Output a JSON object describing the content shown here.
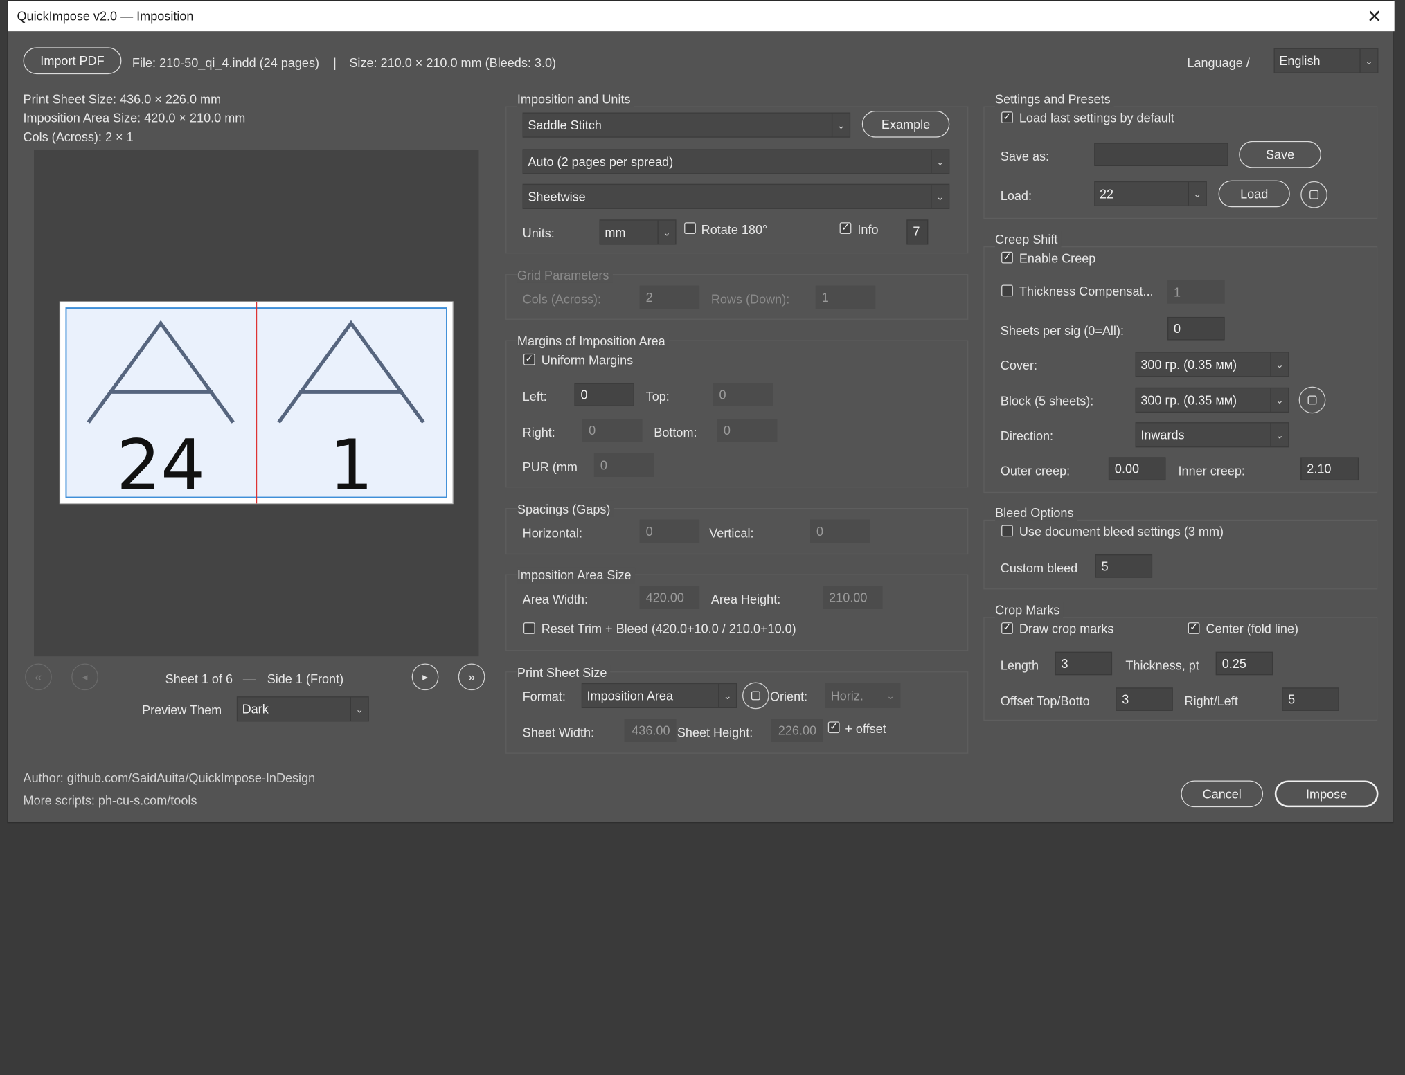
{
  "window": {
    "title": "QuickImpose v2.0 — Imposition"
  },
  "top": {
    "import_label": "Import PDF",
    "file_info": "File: 210-50_qi_4.indd (24 pages)",
    "separator": "|",
    "size_info": "Size: 210.0 × 210.0 mm (Bleeds: 3.0)",
    "language_label": "Language /",
    "language_value": "English"
  },
  "info": {
    "print_sheet": "Print Sheet Size: 436.0 × 226.0 mm",
    "imposition_area": "Imposition Area Size: 420.0 × 210.0 mm",
    "cols": "Cols (Across): 2 × 1"
  },
  "preview": {
    "left_page": "24",
    "right_page": "1",
    "sheet_status": "Sheet 1 of 6",
    "dash": "—",
    "side": "Side 1 (Front)",
    "theme_label": "Preview Them",
    "theme_value": "Dark",
    "first": "«",
    "prev": "◂",
    "next": "▸",
    "last": "»"
  },
  "imposition": {
    "section": "Imposition and Units",
    "method": "Saddle Stitch",
    "example_label": "Example",
    "mode": "Auto (2 pages per spread)",
    "sheetwise": "Sheetwise",
    "units_label": "Units:",
    "units_value": "mm",
    "rotate_label": "Rotate 180°",
    "info_label": "Info",
    "info_value": "7"
  },
  "grid": {
    "section": "Grid Parameters",
    "cols_label": "Cols (Across):",
    "cols_value": "2",
    "rows_label": "Rows (Down):",
    "rows_value": "1"
  },
  "margins": {
    "section": "Margins of Imposition Area",
    "uniform_label": "Uniform Margins",
    "left_label": "Left:",
    "left_value": "0",
    "top_label": "Top:",
    "top_value": "0",
    "right_label": "Right:",
    "right_value": "0",
    "bottom_label": "Bottom:",
    "bottom_value": "0",
    "pur_label": "PUR (mm",
    "pur_value": "0"
  },
  "spacings": {
    "section": "Spacings (Gaps)",
    "horizontal_label": "Horizontal:",
    "horizontal_value": "0",
    "vertical_label": "Vertical:",
    "vertical_value": "0"
  },
  "area_size": {
    "section": "Imposition Area Size",
    "width_label": "Area Width:",
    "width_value": "420.00",
    "height_label": "Area Height:",
    "height_value": "210.00",
    "reset_label": "Reset Trim + Bleed (420.0+10.0 / 210.0+10.0)"
  },
  "print_sheet": {
    "section": "Print Sheet Size",
    "format_label": "Format:",
    "format_value": "Imposition Area",
    "orient_label": "Orient:",
    "orient_value": "Horiz.",
    "width_label": "Sheet Width:",
    "width_value": "436.00",
    "height_label": "Sheet Height:",
    "height_value": "226.00",
    "offset_label": "+ offset"
  },
  "settings": {
    "section": "Settings and Presets",
    "load_default_label": "Load last settings by default",
    "save_as_label": "Save as:",
    "save_as_value": "",
    "save_label": "Save",
    "load_label": "Load:",
    "load_value": "22",
    "load_button": "Load"
  },
  "creep": {
    "section": "Creep Shift",
    "enable_label": "Enable Creep",
    "thickness_label": "Thickness Compensat...",
    "thickness_value": "1",
    "sheets_per_sig_label": "Sheets per sig (0=All):",
    "sheets_per_sig_value": "0",
    "cover_label": "Cover:",
    "cover_value": "300 гр. (0.35 мм)",
    "block_label": "Block (5 sheets):",
    "block_value": "300 гр. (0.35 мм)",
    "direction_label": "Direction:",
    "direction_value": "Inwards",
    "outer_label": "Outer creep:",
    "outer_value": "0.00",
    "inner_label": "Inner creep:",
    "inner_value": "2.10"
  },
  "bleed": {
    "section": "Bleed Options",
    "use_doc_label": "Use document bleed settings (3 mm)",
    "custom_label": "Custom bleed",
    "custom_value": "5"
  },
  "crop": {
    "section": "Crop Marks",
    "draw_label": "Draw crop marks",
    "center_label": "Center (fold line)",
    "length_label": "Length",
    "length_value": "3",
    "thickness_label": "Thickness, pt",
    "thickness_value": "0.25",
    "offset_label": "Offset Top/Botto",
    "offset_value": "3",
    "rightleft_label": "Right/Left",
    "rightleft_value": "5"
  },
  "footer": {
    "author": "Author: github.com/SaidAuita/QuickImpose-InDesign",
    "more": "More scripts: ph-cu-s.com/tools",
    "cancel_label": "Cancel",
    "impose_label": "Impose"
  },
  "glyphs": {
    "check": "✓",
    "close": "✕",
    "dropdown": "⌄"
  }
}
